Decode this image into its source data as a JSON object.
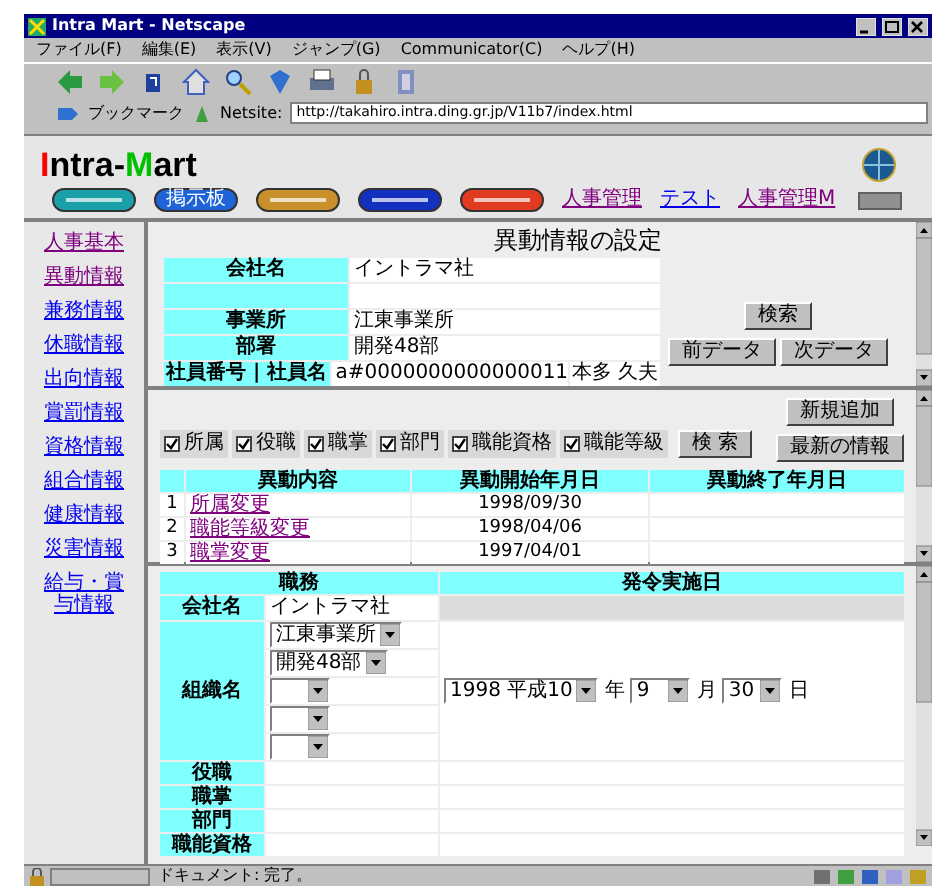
{
  "window": {
    "title": "Intra Mart - Netscape"
  },
  "menu": [
    "ファイル(F)",
    "編集(E)",
    "表示(V)",
    "ジャンプ(G)",
    "Communicator(C)",
    "ヘルプ(H)"
  ],
  "location_bar": {
    "bookmarks": "ブックマーク",
    "label": "Netsite:",
    "url": "http://takahiro.intra.ding.gr.jp/V11b7/index.html"
  },
  "header": {
    "logo": [
      {
        "text": "I",
        "color": "#ff0000"
      },
      {
        "text": "ntra-",
        "color": "#000000"
      },
      {
        "text": "M",
        "color": "#00c000"
      },
      {
        "text": "art",
        "color": "#000000"
      }
    ],
    "nav_buttons": [
      {
        "color": "#1aa0a8"
      },
      {
        "label": "掲示板",
        "color": "#1e64d8"
      },
      {
        "color": "#c8902a"
      },
      {
        "color": "#1430c0"
      },
      {
        "color": "#e03a20"
      }
    ],
    "links": [
      {
        "label": "人事管理",
        "visited": true
      },
      {
        "label": "テスト",
        "visited": false
      },
      {
        "label": "人事管理M",
        "visited": true
      }
    ]
  },
  "sidebar": {
    "items": [
      {
        "label": "人事基本",
        "visited": true
      },
      {
        "label": "異動情報",
        "visited": true
      },
      {
        "label": "兼務情報",
        "visited": false
      },
      {
        "label": "休職情報",
        "visited": false
      },
      {
        "label": "出向情報",
        "visited": false
      },
      {
        "label": "賞罰情報",
        "visited": false
      },
      {
        "label": "資格情報",
        "visited": false
      },
      {
        "label": "組合情報",
        "visited": false
      },
      {
        "label": "健康情報",
        "visited": false
      },
      {
        "label": "災害情報",
        "visited": false
      },
      {
        "label": "給与・賞与情報",
        "visited": false
      }
    ]
  },
  "employee_form": {
    "title": "異動情報の設定",
    "rows": [
      {
        "label": "会社名",
        "values": [
          "イントラマ社"
        ]
      },
      {
        "values": []
      },
      {
        "label": "事業所",
        "values": [
          "江東事業所"
        ]
      },
      {
        "label": "部署",
        "values": [
          "開発48部"
        ]
      },
      {
        "label": "社員番号 | 社員名",
        "values": [
          "a#0000000000000011",
          "本多 久夫"
        ]
      }
    ],
    "search_button": "検索",
    "prev_button": "前データ",
    "next_button": "次データ"
  },
  "filters": {
    "items": [
      {
        "label": "所属",
        "checked": true
      },
      {
        "label": "役職",
        "checked": true
      },
      {
        "label": "職掌",
        "checked": true
      },
      {
        "label": "部門",
        "checked": true
      },
      {
        "label": "職能資格",
        "checked": true
      },
      {
        "label": "職能等級",
        "checked": true
      }
    ],
    "search_button": "検 索",
    "new_button": "新規追加",
    "refresh_button": "最新の情報"
  },
  "history_table": {
    "columns": [
      "異動内容",
      "異動開始年月日",
      "異動終了年月日"
    ],
    "rows": [
      {
        "no": "1",
        "change": "所属変更",
        "start": "1998/09/30"
      },
      {
        "no": "2",
        "change": "職能等級変更",
        "start": "1998/04/06"
      },
      {
        "no": "3",
        "change": "職掌変更",
        "start": "1997/04/01"
      }
    ]
  },
  "detail": {
    "columns": [
      "職務",
      "発令実施日"
    ],
    "company": {
      "label": "会社名",
      "value": "イントラマ社"
    },
    "org_label": "組織名",
    "org_selects": [
      {
        "kind": "select",
        "value": "江東事業所"
      },
      {
        "kind": "select",
        "value": "開発48部"
      },
      {
        "kind": "select"
      },
      {
        "kind": "select"
      },
      {
        "kind": "select"
      }
    ],
    "date": {
      "year": "1998 平成10",
      "year_unit": "年",
      "month": "9",
      "month_unit": "月",
      "day": "30",
      "day_unit": "日"
    },
    "rows": [
      "役職",
      "職掌",
      "部門",
      "職能資格"
    ]
  },
  "status_bar": {
    "text": "ドキュメント: 完了。"
  }
}
